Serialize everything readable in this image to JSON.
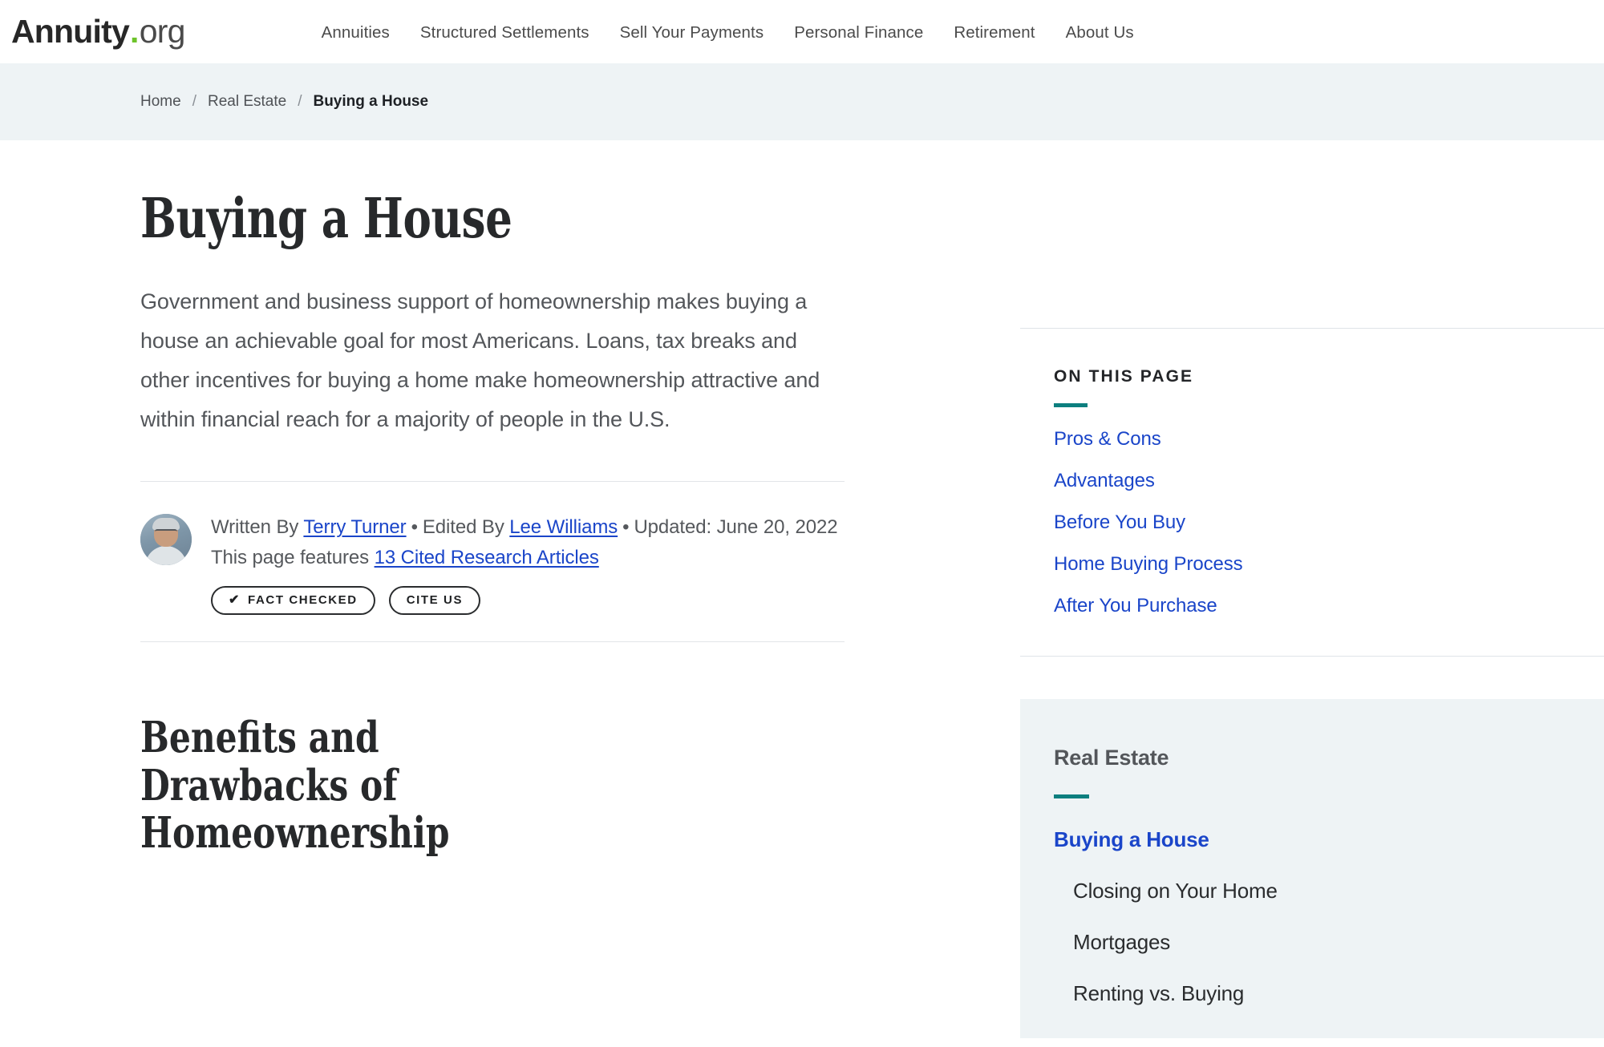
{
  "header": {
    "logo": {
      "main": "Annuity",
      "dot": ".",
      "tld": "org"
    },
    "nav": [
      {
        "label": "Annuities"
      },
      {
        "label": "Structured Settlements"
      },
      {
        "label": "Sell Your Payments"
      },
      {
        "label": "Personal Finance"
      },
      {
        "label": "Retirement"
      },
      {
        "label": "About Us"
      }
    ]
  },
  "breadcrumb": {
    "items": [
      {
        "label": "Home"
      },
      {
        "label": "Real Estate"
      },
      {
        "label": "Buying a House"
      }
    ],
    "separator": "/"
  },
  "article": {
    "title": "Buying a House",
    "intro": "Government and business support of homeownership makes buying a house an achievable goal for most Americans. Loans, tax breaks and other incentives for buying a home make homeownership attractive and within financial reach for a majority of people in the U.S.",
    "byline": {
      "written_by_label": "Written By",
      "author": "Terry Turner",
      "edited_by_label": "Edited By",
      "editor": "Lee Williams",
      "updated_label": "Updated: June 20, 2022",
      "features_prefix": "This page features",
      "citations_link": "13 Cited Research Articles",
      "separator": "•"
    },
    "badges": {
      "fact_checked": "FACT CHECKED",
      "check_icon": "✔",
      "cite_us": "CITE US"
    },
    "section_heading": "Benefits and Drawbacks of Homeownership"
  },
  "sidebar": {
    "toc": {
      "heading": "ON THIS PAGE",
      "accent_color": "#0d7f7f",
      "links": [
        {
          "label": "Pros & Cons"
        },
        {
          "label": "Advantages"
        },
        {
          "label": "Before You Buy"
        },
        {
          "label": "Home Buying Process"
        },
        {
          "label": "After You Purchase"
        }
      ]
    },
    "category": {
      "title": "Real Estate",
      "accent_color": "#0d7f7f",
      "items": [
        {
          "label": "Buying a House",
          "active": true
        },
        {
          "label": "Closing on Your Home",
          "active": false
        },
        {
          "label": "Mortgages",
          "active": false
        },
        {
          "label": "Renting vs. Buying",
          "active": false
        }
      ]
    }
  },
  "colors": {
    "link_blue": "#1a45c9",
    "teal_accent": "#0d7f7f",
    "logo_green": "#6dc32a",
    "breadcrumb_bg": "#eef3f5",
    "card_bg": "#eef3f5"
  }
}
